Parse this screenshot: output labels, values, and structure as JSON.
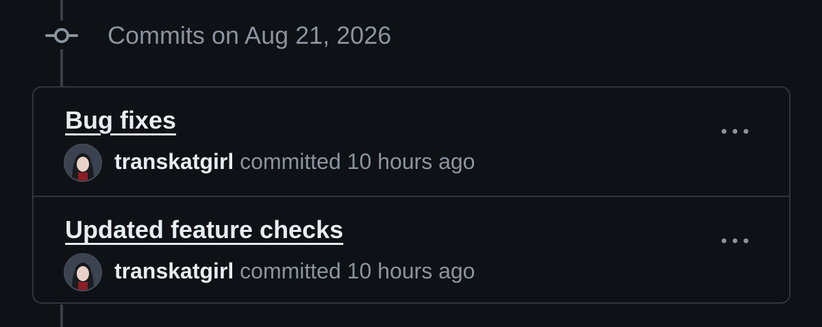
{
  "group": {
    "heading": "Commits on Aug 21, 2026"
  },
  "commits": [
    {
      "title": "Bug fixes",
      "author": "transkatgirl",
      "action": "committed",
      "time": "10 hours ago"
    },
    {
      "title": "Updated feature checks",
      "author": "transkatgirl",
      "action": "committed",
      "time": "10 hours ago"
    }
  ],
  "icons": {
    "timeline_node": "git-commit-icon",
    "more": "kebab-horizontal-icon",
    "avatar": "user-avatar"
  },
  "colors": {
    "background": "#0e1116",
    "border": "#30363d",
    "text_primary": "#e6edf3",
    "text_muted": "#8b949e"
  }
}
